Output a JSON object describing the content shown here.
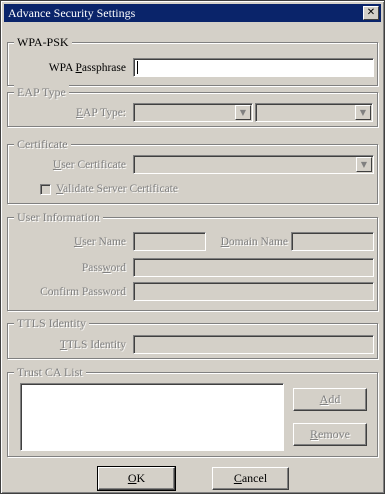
{
  "window": {
    "title": "Advance Security Settings",
    "close_glyph": "✕"
  },
  "wpa_psk": {
    "legend": "WPA-PSK",
    "passphrase_label_pre": "WPA ",
    "passphrase_label_key": "P",
    "passphrase_label_post": "assphrase",
    "passphrase_value": ""
  },
  "eap": {
    "legend": "EAP Type",
    "type_label_key": "E",
    "type_label_post": "AP Type:",
    "type_value": "",
    "subtype_value": ""
  },
  "certificate": {
    "legend": "Certificate",
    "user_cert_label_key": "U",
    "user_cert_label_post": "ser Certificate",
    "user_cert_value": "",
    "validate_key": "V",
    "validate_post": "alidate Server Certificate"
  },
  "user_info": {
    "legend": "User Information",
    "user_name_pre": "",
    "user_name_key": "U",
    "user_name_post": "ser Name",
    "domain_key": "D",
    "domain_post": "omain Name",
    "password_pre": "Pass",
    "password_key": "w",
    "password_post": "ord",
    "confirm_label": "Confirm Password",
    "user_name_value": "",
    "domain_value": "",
    "password_value": "",
    "confirm_value": ""
  },
  "ttls": {
    "legend": "TTLS Identity",
    "identity_key": "T",
    "identity_post": "TLS Identity",
    "identity_value": ""
  },
  "trust_ca": {
    "legend": "Trust CA List",
    "add_key": "A",
    "add_post": "dd",
    "remove_key": "R",
    "remove_post": "emove"
  },
  "footer": {
    "ok_key": "O",
    "ok_post": "K",
    "cancel_key": "C",
    "cancel_post": "ancel"
  }
}
